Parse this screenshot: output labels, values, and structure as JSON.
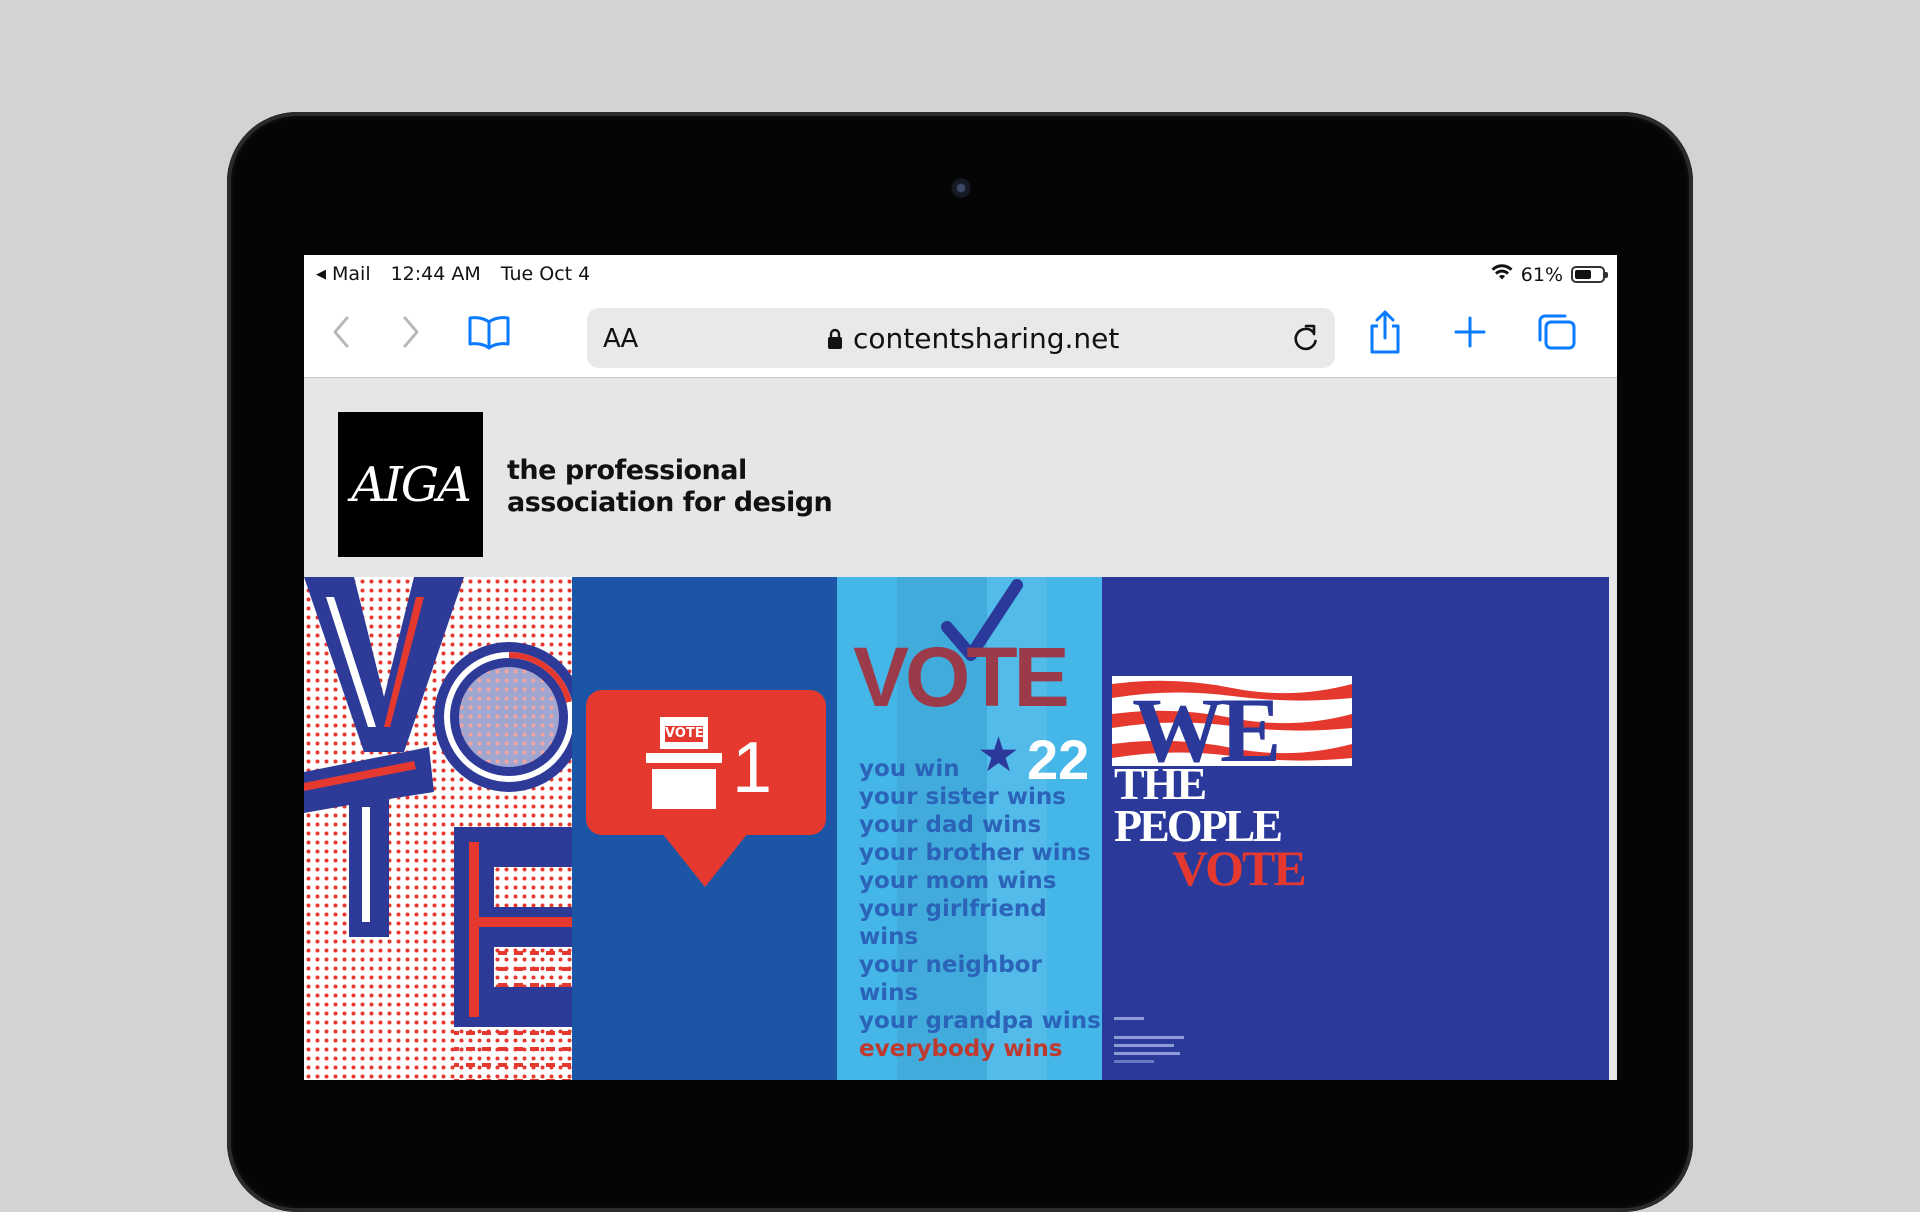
{
  "status_bar": {
    "back_app": "Mail",
    "time": "12:44 AM",
    "date": "Tue Oct 4",
    "battery": "61%",
    "battery_level": 0.61
  },
  "browser": {
    "text_size_label": "AA",
    "url": "contentsharing.net"
  },
  "page": {
    "logo_text": "AIGA",
    "tagline_line1": "the professional",
    "tagline_line2": "association for design"
  },
  "posters": {
    "p1": {
      "letters": "VOTE"
    },
    "p2": {
      "box_label": "VOTE",
      "count": "1"
    },
    "p3": {
      "headline": "VOTE",
      "number": "22",
      "lines": [
        "you win",
        "your sister wins",
        "your dad wins",
        "your brother wins",
        "your mom wins",
        "your girlfriend wins",
        "your neighbor wins",
        "your grandpa wins",
        "everybody wins"
      ]
    },
    "p4": {
      "line1": "WE",
      "line2": "THE",
      "line3": "PEOPLE",
      "line4": "VOTE"
    }
  },
  "colors": {
    "ios_blue": "#0a7aff",
    "poster_red": "#e5392f",
    "poster_navy": "#2b3a9a",
    "poster_blue": "#1d55a6",
    "poster_sky": "#45b6e8"
  }
}
